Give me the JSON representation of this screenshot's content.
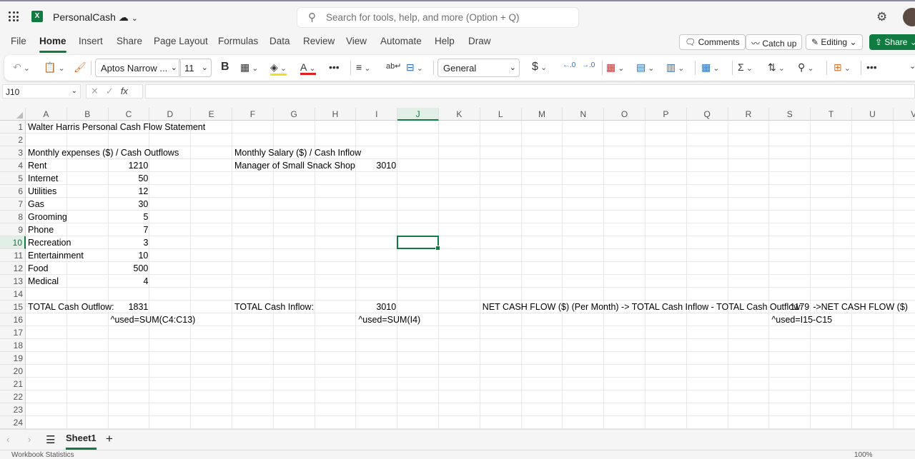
{
  "app": {
    "file_name": "PersonalCash",
    "search_placeholder": "Search for tools, help, and more (Option + Q)"
  },
  "menu": [
    "File",
    "Home",
    "Insert",
    "Share",
    "Page Layout",
    "Formulas",
    "Data",
    "Review",
    "View",
    "Automate",
    "Help",
    "Draw"
  ],
  "active_menu": "Home",
  "header_buttons": {
    "comments": "Comments",
    "catch_up": "Catch up",
    "editing": "Editing",
    "share": "Share"
  },
  "ribbon": {
    "font_name": "Aptos Narrow ...",
    "font_size": "11",
    "number_format": "General",
    "bold": "B",
    "currency": "$",
    "more": "•••"
  },
  "formula_bar": {
    "name_box": "J10",
    "fx": "fx",
    "formula": ""
  },
  "columns": [
    "A",
    "B",
    "C",
    "D",
    "E",
    "F",
    "G",
    "H",
    "I",
    "J",
    "K",
    "L",
    "M",
    "N",
    "O",
    "P",
    "Q",
    "R",
    "S",
    "T",
    "U",
    "V"
  ],
  "rows": [
    "1",
    "2",
    "3",
    "4",
    "5",
    "6",
    "7",
    "8",
    "9",
    "10",
    "11",
    "12",
    "13",
    "14",
    "15",
    "16",
    "17",
    "18",
    "19",
    "20",
    "21",
    "22",
    "23",
    "24"
  ],
  "selected_cell": "J10",
  "cells": [
    {
      "col": 0,
      "row": 0,
      "v": "Walter Harris Personal Cash Flow Statement"
    },
    {
      "col": 0,
      "row": 2,
      "v": "Monthly expenses ($) / Cash Outflows"
    },
    {
      "col": 5,
      "row": 2,
      "v": "Monthly Salary ($) / Cash Inflow"
    },
    {
      "col": 0,
      "row": 3,
      "v": "Rent"
    },
    {
      "col": 2,
      "row": 3,
      "v": "1210",
      "num": true
    },
    {
      "col": 5,
      "row": 3,
      "v": "Manager of Small Snack Shop"
    },
    {
      "col": 8,
      "row": 3,
      "v": "3010",
      "num": true
    },
    {
      "col": 0,
      "row": 4,
      "v": "Internet"
    },
    {
      "col": 2,
      "row": 4,
      "v": "50",
      "num": true
    },
    {
      "col": 0,
      "row": 5,
      "v": "Utilities"
    },
    {
      "col": 2,
      "row": 5,
      "v": "12",
      "num": true
    },
    {
      "col": 0,
      "row": 6,
      "v": "Gas"
    },
    {
      "col": 2,
      "row": 6,
      "v": "30",
      "num": true
    },
    {
      "col": 0,
      "row": 7,
      "v": "Grooming"
    },
    {
      "col": 2,
      "row": 7,
      "v": "5",
      "num": true
    },
    {
      "col": 0,
      "row": 8,
      "v": "Phone"
    },
    {
      "col": 2,
      "row": 8,
      "v": "7",
      "num": true
    },
    {
      "col": 0,
      "row": 9,
      "v": "Recreation"
    },
    {
      "col": 2,
      "row": 9,
      "v": "3",
      "num": true
    },
    {
      "col": 0,
      "row": 10,
      "v": "Entertainment"
    },
    {
      "col": 2,
      "row": 10,
      "v": "10",
      "num": true
    },
    {
      "col": 0,
      "row": 11,
      "v": "Food"
    },
    {
      "col": 2,
      "row": 11,
      "v": "500",
      "num": true
    },
    {
      "col": 0,
      "row": 12,
      "v": "Medical"
    },
    {
      "col": 2,
      "row": 12,
      "v": "4",
      "num": true
    },
    {
      "col": 0,
      "row": 14,
      "v": "TOTAL Cash Outflow:"
    },
    {
      "col": 2,
      "row": 14,
      "v": "1831",
      "num": true
    },
    {
      "col": 5,
      "row": 14,
      "v": "TOTAL Cash Inflow:"
    },
    {
      "col": 8,
      "row": 14,
      "v": "3010",
      "num": true
    },
    {
      "col": 11,
      "row": 14,
      "v": "NET CASH FLOW ($) (Per Month) -> TOTAL Cash Inflow - TOTAL Cash Outflow:"
    },
    {
      "col": 18,
      "row": 14,
      "v": "1179",
      "num": true
    },
    {
      "col": 19,
      "row": 14,
      "v": "->NET CASH FLOW ($)"
    },
    {
      "col": 2,
      "row": 15,
      "v": "^used=SUM(C4:C13)"
    },
    {
      "col": 8,
      "row": 15,
      "v": "^used=SUM(I4)"
    },
    {
      "col": 18,
      "row": 15,
      "v": "^used=I15-C15"
    }
  ],
  "sheets": [
    "Sheet1"
  ],
  "status": {
    "left": "Workbook Statistics",
    "zoom": "100%"
  }
}
